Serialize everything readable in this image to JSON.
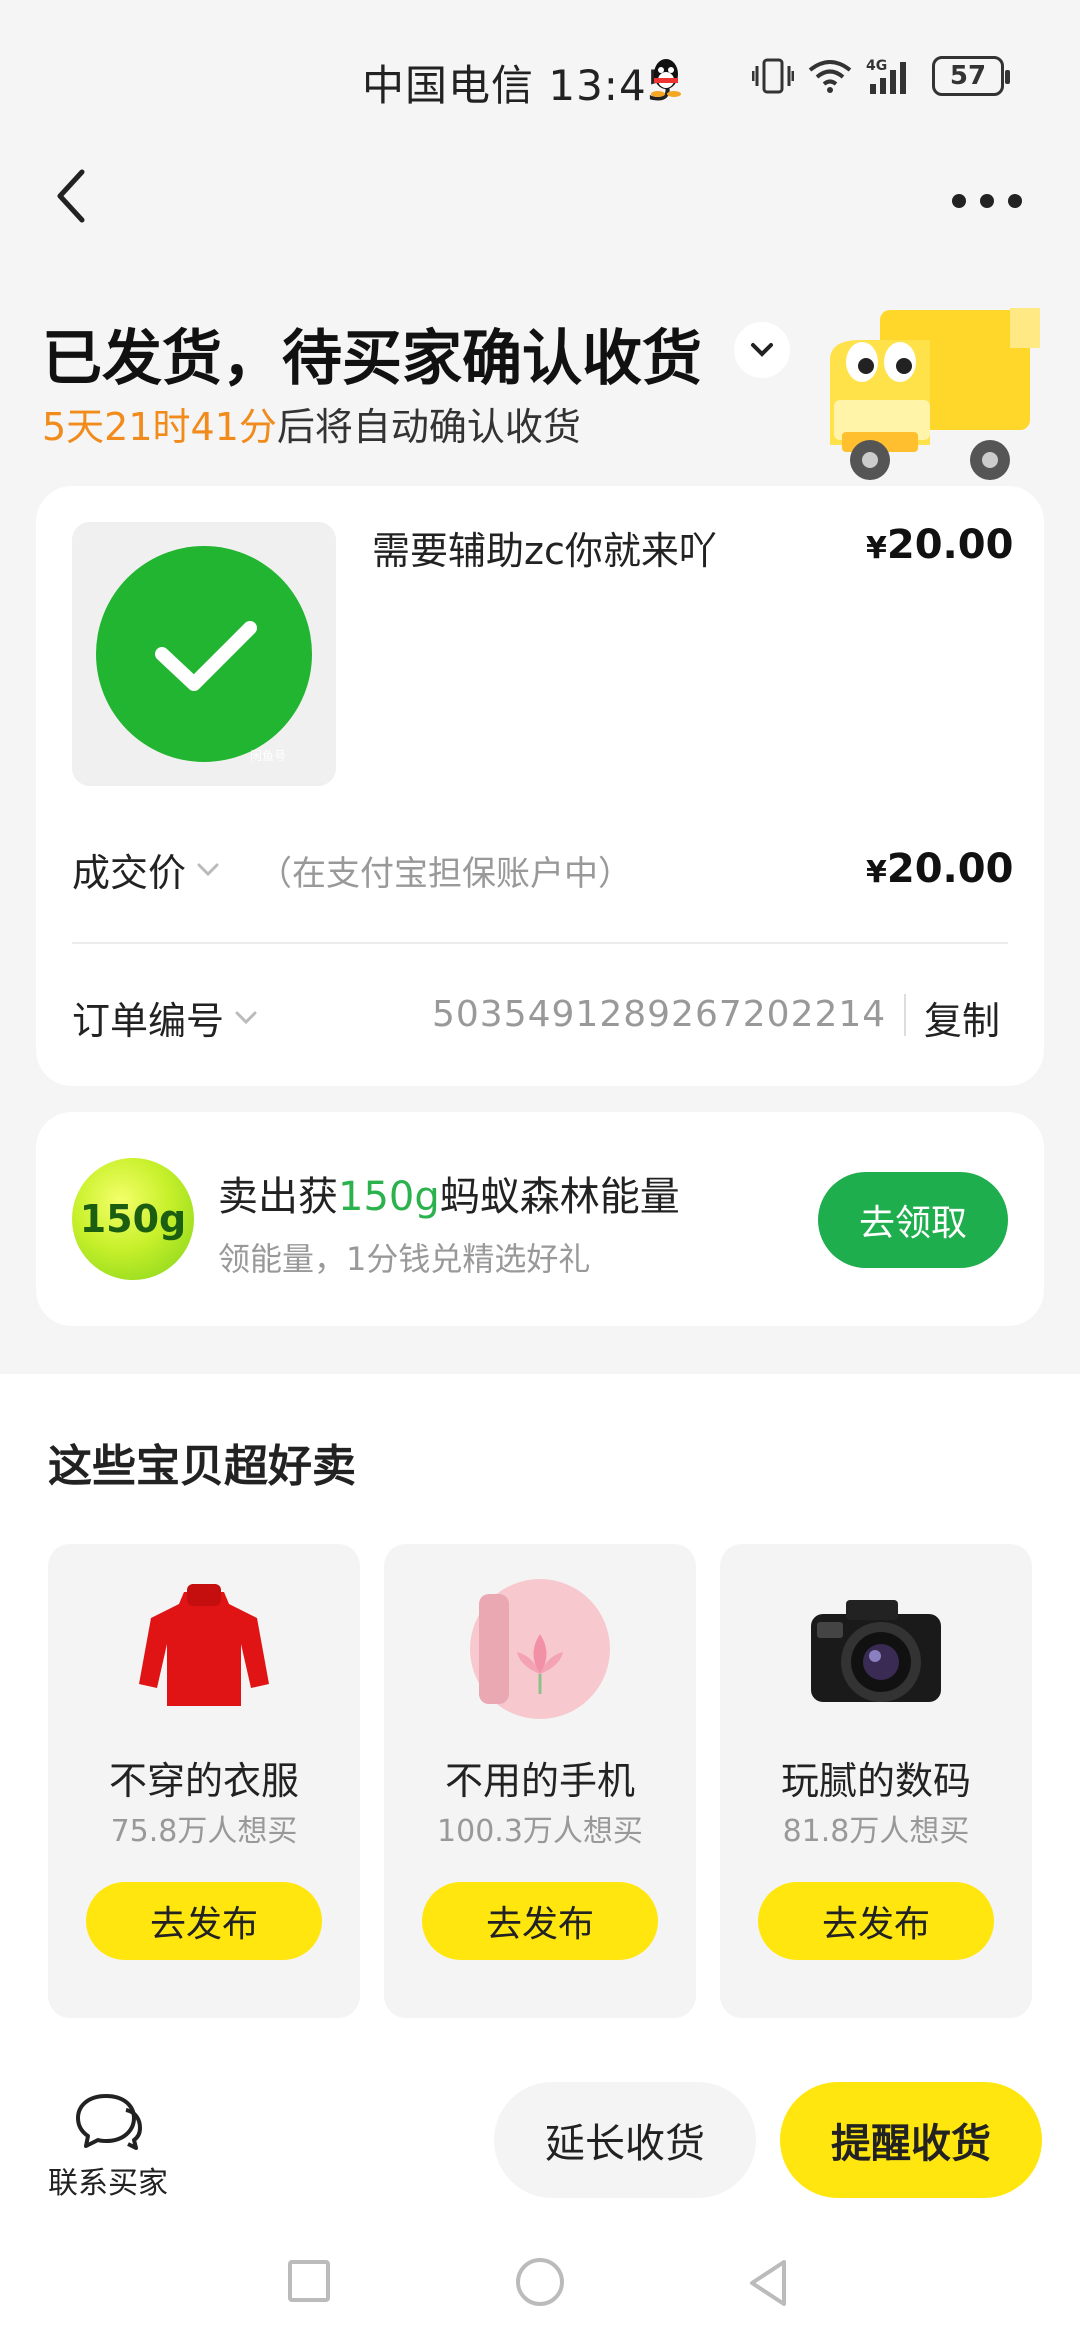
{
  "status_bar": {
    "carrier_time": "中国电信 13:45",
    "network": "4G",
    "battery": "57"
  },
  "header": {
    "back_icon": "chevron-left-icon",
    "more_icon": "more-icon"
  },
  "order": {
    "status_title": "已发货，待买家确认收货",
    "countdown": "5天21时41分",
    "countdown_suffix": "后将自动确认收货",
    "countdown_color": "#f08b1c"
  },
  "product": {
    "title": "需要辅助zc你就来吖",
    "currency": "¥",
    "price": "20.00",
    "thumb_watermark": "闲鱼号"
  },
  "deal": {
    "label": "成交价",
    "note": "（在支付宝担保账户中）",
    "currency": "¥",
    "price": "20.00"
  },
  "order_number": {
    "label": "订单编号",
    "value": "5035491289267202214",
    "copy_label": "复制"
  },
  "energy": {
    "badge": "150g",
    "title_prefix": "卖出获",
    "title_highlight": "150g",
    "title_suffix": "蚂蚁森林能量",
    "subtitle": "领能量，1分钱兑精选好礼",
    "claim_label": "去领取",
    "accent_color": "#1fae4d"
  },
  "recommend": {
    "heading": "这些宝贝超好卖",
    "items": [
      {
        "name": "不穿的衣服",
        "count": "75.8万人想买",
        "button": "去发布",
        "icon": "sweater-icon"
      },
      {
        "name": "不用的手机",
        "count": "100.3万人想买",
        "button": "去发布",
        "icon": "phone-icon"
      },
      {
        "name": "玩腻的数码",
        "count": "81.8万人想买",
        "button": "去发布",
        "icon": "camera-icon"
      }
    ]
  },
  "actions": {
    "contact_label": "联系买家",
    "extend_label": "延长收货",
    "remind_label": "提醒收货",
    "primary_color": "#ffe60f"
  }
}
